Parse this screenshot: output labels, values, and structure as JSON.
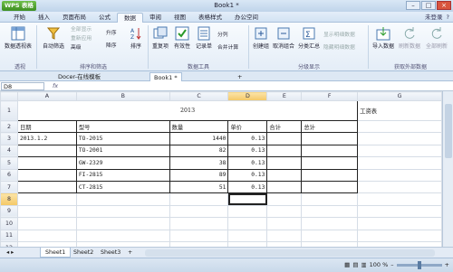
{
  "titlebar": {
    "app_name": "WPS 表格",
    "doc_title": "Book1 *"
  },
  "menu": {
    "tabs": [
      "开始",
      "插入",
      "页面布局",
      "公式",
      "数据",
      "审阅",
      "视图",
      "表格样式",
      "办公空间"
    ],
    "active": "数据",
    "user": "未登录"
  },
  "ribbon": {
    "pivot": "数据透视表",
    "autofilter": "自动筛选",
    "filter_all": "全部显示",
    "reapply": "重新应用",
    "advanced": "高级",
    "sort_asc": "升序",
    "sort_desc": "降序",
    "sort": "排序",
    "duplicates": "重复项",
    "validity": "有效性",
    "recordlist": "记录单",
    "split": "分列",
    "consolidate": "合并计算",
    "create_group": "创建组",
    "ungroup": "取消组合",
    "subtotal": "分类汇总",
    "show_detail": "显示明细数据",
    "hide_detail": "隐藏明细数据",
    "import": "导入数据",
    "refresh": "刷新数据",
    "refresh_all": "全部刷新",
    "groups": [
      "透视",
      "排序和筛选",
      "数据工具",
      "分级显示",
      "获取外部数据"
    ]
  },
  "doctabs": [
    "Docer-在线模板",
    "Book1 *"
  ],
  "formula": {
    "namebox": "D8",
    "fx": "fx"
  },
  "sheet": {
    "columns": [
      "A",
      "B",
      "C",
      "D",
      "E",
      "F",
      "G"
    ],
    "rows": [
      "1",
      "2",
      "3",
      "4",
      "5",
      "6",
      "7",
      "8",
      "9",
      "10",
      "11",
      "12",
      "13"
    ],
    "title": "2013",
    "side_label": "工资表",
    "headers": [
      "日期",
      "型号",
      "数量",
      "单价",
      "合计",
      "总计"
    ],
    "data": [
      [
        "2013.1.2",
        "TO-2015",
        "1440",
        "0.13"
      ],
      [
        "",
        "TO-2001",
        "82",
        "0.13"
      ],
      [
        "",
        "GW-2329",
        "38",
        "0.13"
      ],
      [
        "",
        "FI-2815",
        "89",
        "0.13"
      ],
      [
        "",
        "CT-2815",
        "51",
        "0.13"
      ]
    ]
  },
  "sheettabs": [
    "Sheet1",
    "Sheet2",
    "Sheet3"
  ],
  "status": {
    "zoom": "100 %"
  }
}
